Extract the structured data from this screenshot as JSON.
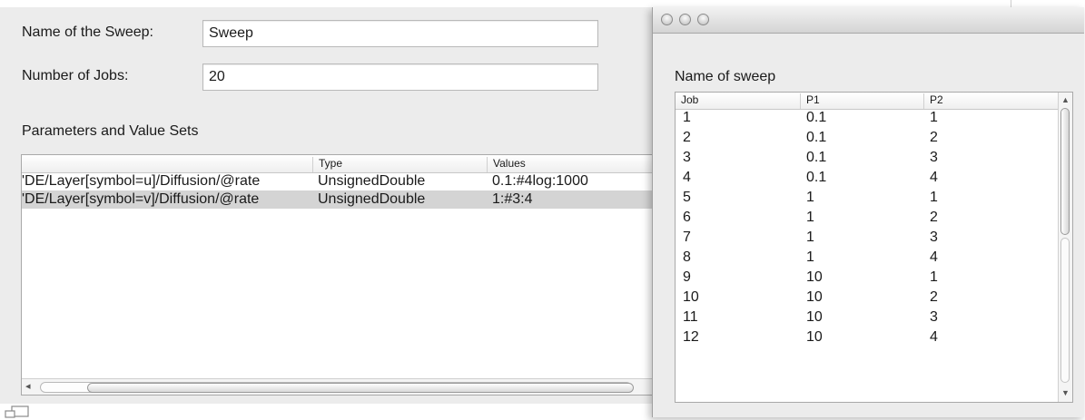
{
  "form": {
    "sweep_name_label": "Name of the Sweep:",
    "sweep_name_value": "Sweep",
    "jobs_label": "Number of Jobs:",
    "jobs_value": "20"
  },
  "parameters": {
    "heading": "Parameters and Value Sets",
    "columns": [
      "",
      "Type",
      "Values"
    ],
    "rows": [
      {
        "path": "'DE/Layer[symbol=u]/Diffusion/@rate",
        "type": "UnsignedDouble",
        "values": "0.1:#4log:1000",
        "selected": false
      },
      {
        "path": "'DE/Layer[symbol=v]/Diffusion/@rate",
        "type": "UnsignedDouble",
        "values": "1:#3:4",
        "selected": true
      }
    ],
    "scroll_left_icon": "left-arrow-icon"
  },
  "sweep_window": {
    "heading": "Name of sweep",
    "columns": [
      "Job",
      "P1",
      "P2"
    ],
    "rows": [
      [
        "1",
        "0.1",
        "1"
      ],
      [
        "2",
        "0.1",
        "2"
      ],
      [
        "3",
        "0.1",
        "3"
      ],
      [
        "4",
        "0.1",
        "4"
      ],
      [
        "5",
        "1",
        "1"
      ],
      [
        "6",
        "1",
        "2"
      ],
      [
        "7",
        "1",
        "3"
      ],
      [
        "8",
        "1",
        "4"
      ],
      [
        "9",
        "10",
        "1"
      ],
      [
        "10",
        "10",
        "2"
      ],
      [
        "11",
        "10",
        "3"
      ],
      [
        "12",
        "10",
        "4"
      ]
    ],
    "window_buttons": [
      "close-button-icon",
      "minimize-button-icon",
      "zoom-button-icon"
    ]
  },
  "colors": {
    "panel_bg": "#ececec",
    "selected_row": "#d4d4d4"
  }
}
